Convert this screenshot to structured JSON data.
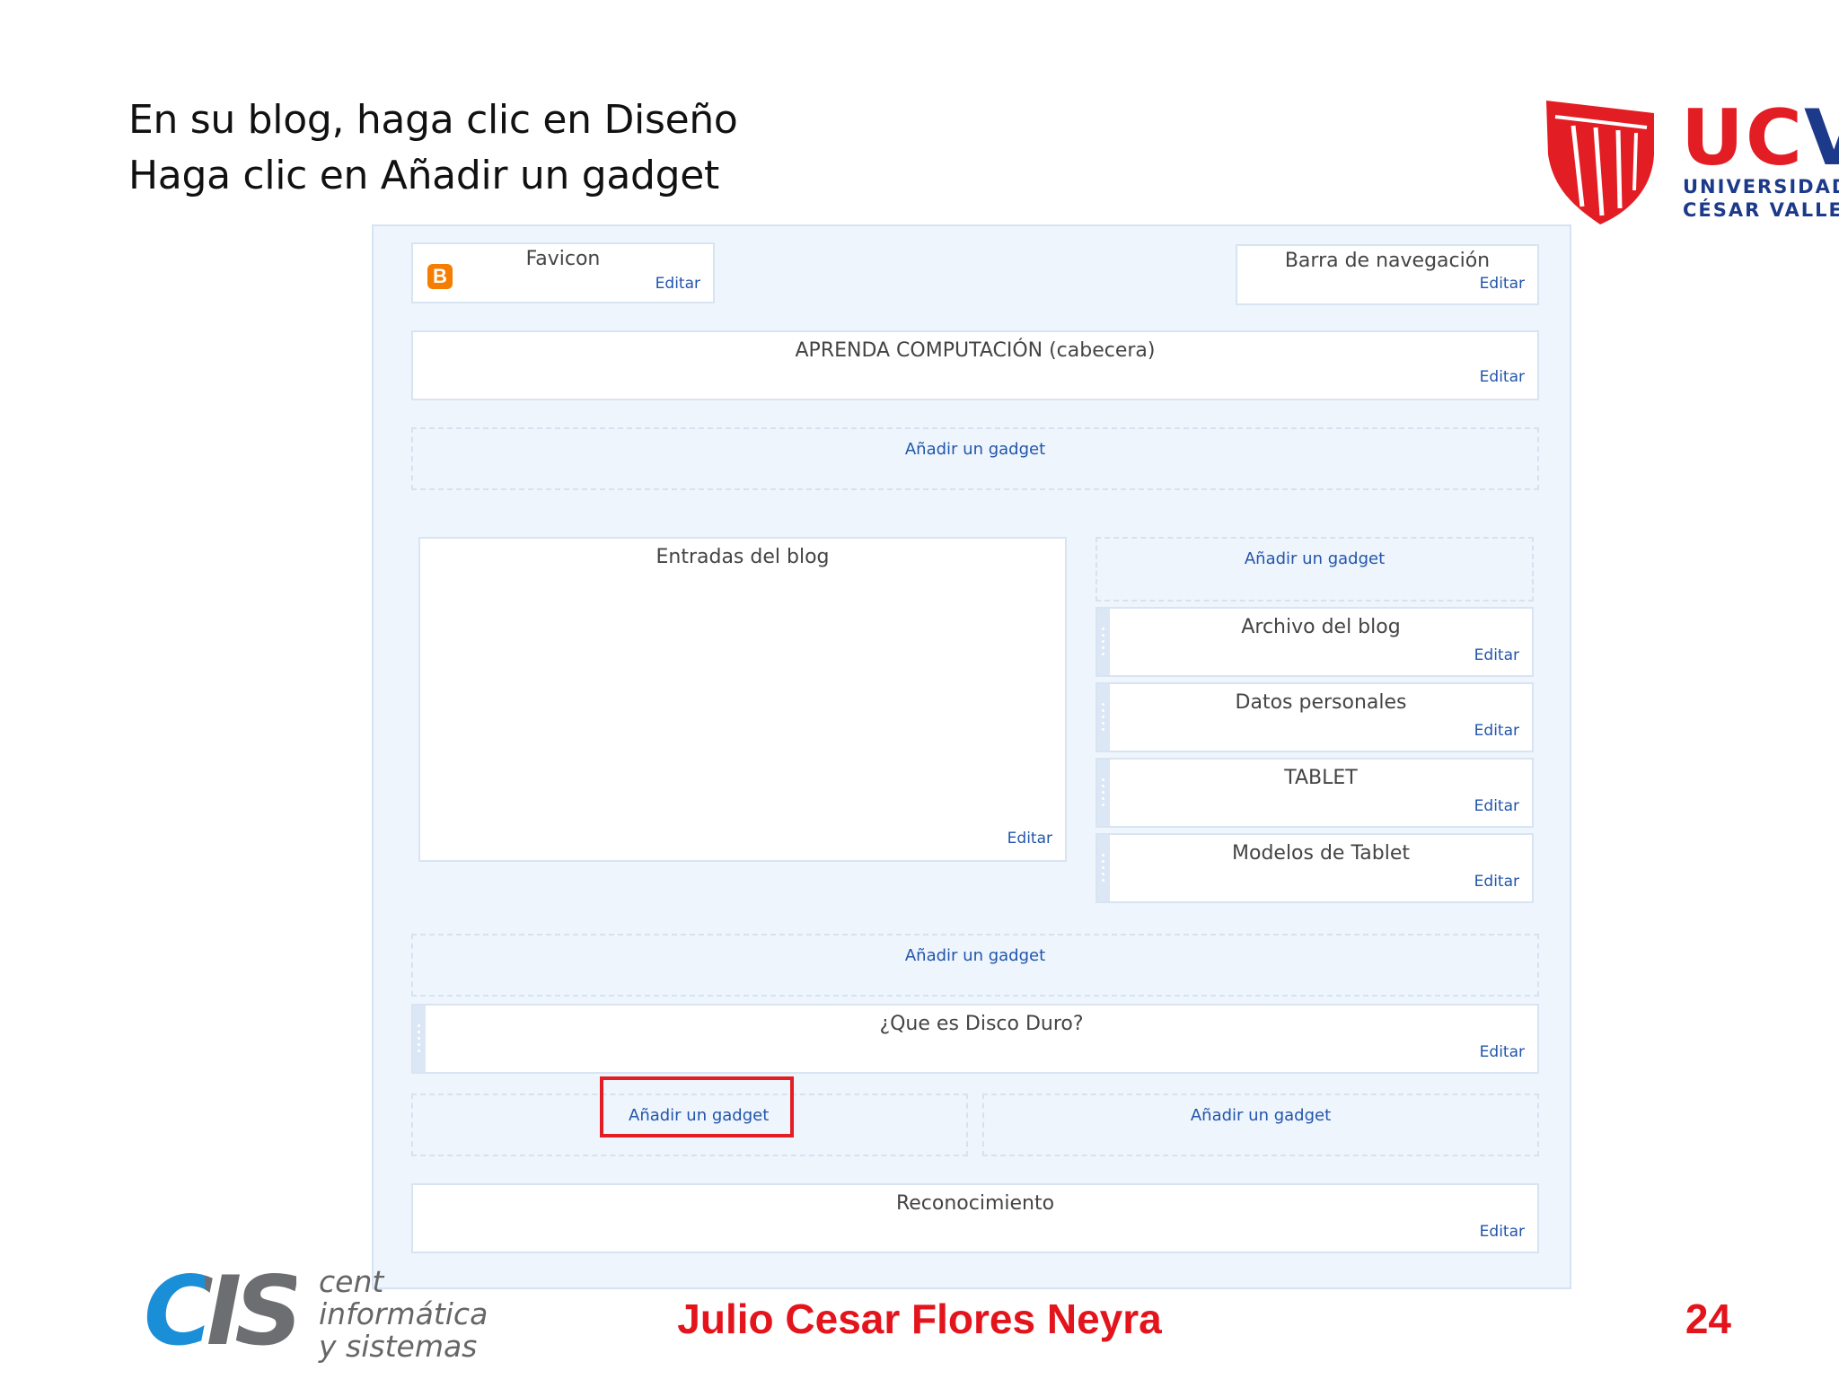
{
  "instructions": [
    "En su blog, haga clic en Diseño",
    "Haga clic en Añadir un gadget"
  ],
  "logo_ucv": {
    "title": "UCV",
    "line1": "UNIVERSIDAD",
    "line2": "CÉSAR VALLEJO",
    "colors": {
      "red": "#e31d24",
      "blue": "#1d3a8a"
    }
  },
  "layout": {
    "add_gadget_label": "Añadir un gadget",
    "edit_label": "Editar",
    "favicon": {
      "title": "Favicon",
      "icon": "blogger-icon",
      "icon_letter": "B"
    },
    "navbar": {
      "title": "Barra de navegación"
    },
    "header": {
      "title": "APRENDA COMPUTACIÓN (cabecera)"
    },
    "posts": {
      "title": "Entradas del blog"
    },
    "sidebar_gadgets": [
      {
        "title": "Archivo del blog"
      },
      {
        "title": "Datos personales"
      },
      {
        "title": "TABLET"
      },
      {
        "title": "Modelos de Tablet"
      }
    ],
    "footer_gadget": {
      "title": "¿Que es Disco Duro?"
    },
    "attribution": {
      "title": "Reconocimiento"
    }
  },
  "logo_cis": {
    "letters": "CIS",
    "line1": "cent",
    "line2": "informática",
    "line3": "y sistemas",
    "colors": {
      "blue": "#1a8fd8",
      "gray": "#6d6e71"
    }
  },
  "footer": {
    "author": "Julio Cesar Flores Neyra",
    "page_number": "24"
  },
  "colors": {
    "accent_red": "#e3141c",
    "link_blue": "#2255aa",
    "panel_bg": "#eef5fd"
  }
}
